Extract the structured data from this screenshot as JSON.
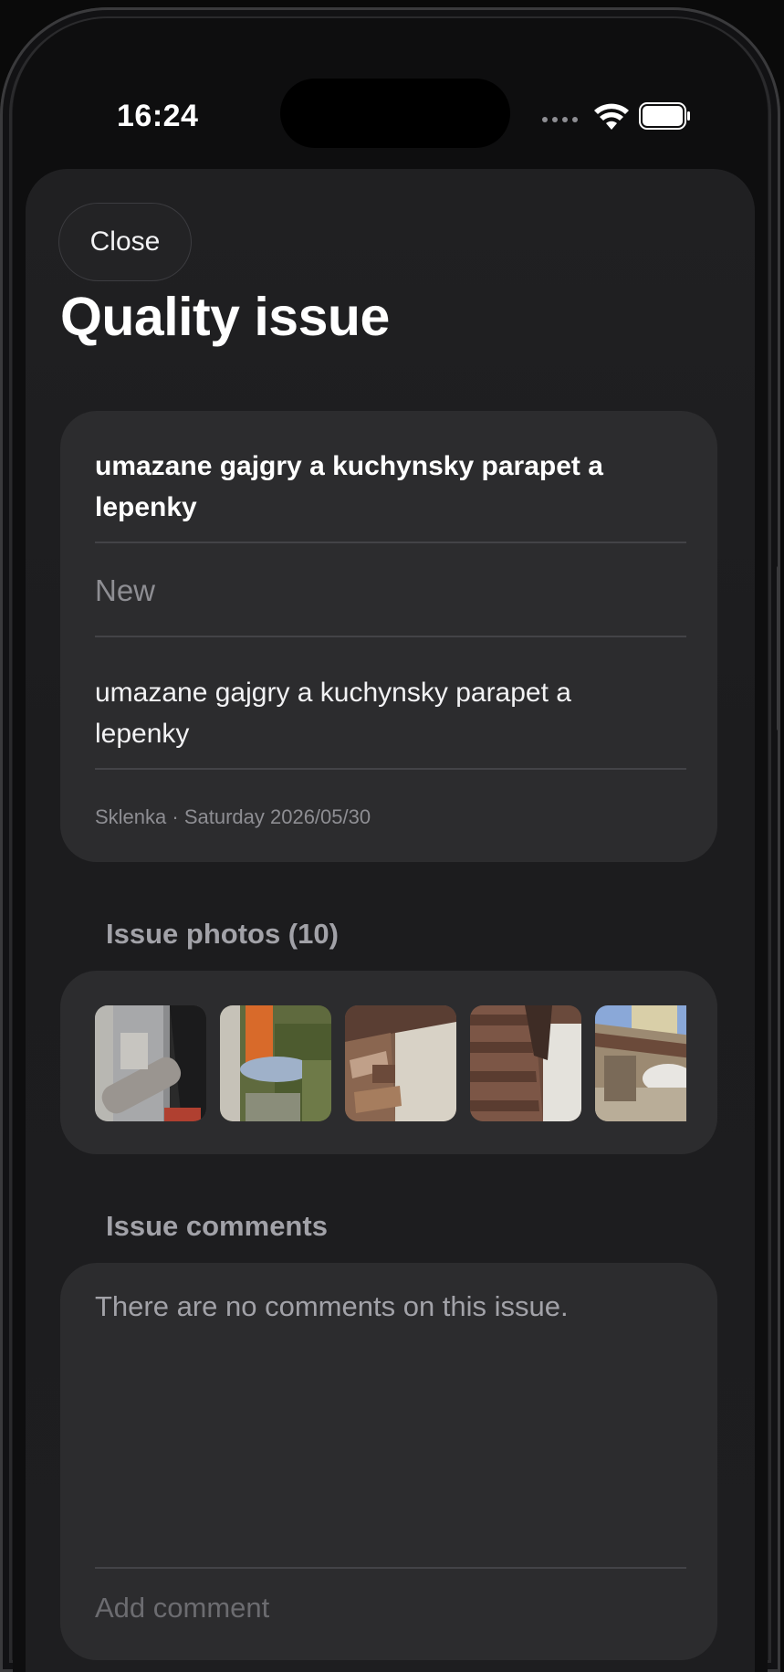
{
  "status_bar": {
    "time": "16:24"
  },
  "sheet": {
    "close_label": "Close",
    "title": "Quality issue"
  },
  "issue": {
    "title": "umazane gajgry a kuchynsky parapet a lepenky",
    "status": "New",
    "description": "umazane gajgry a kuchynsky parapet a lepenky",
    "meta": "Sklenka · Saturday 2026/05/30"
  },
  "photos": {
    "title": "Issue photos (10)",
    "count": 10
  },
  "comments": {
    "title": "Issue comments",
    "empty_text": "There are no comments on this issue.",
    "input_placeholder": "Add comment"
  },
  "icons": [
    "wifi-icon",
    "battery-icon",
    "signal-dots-icon"
  ]
}
